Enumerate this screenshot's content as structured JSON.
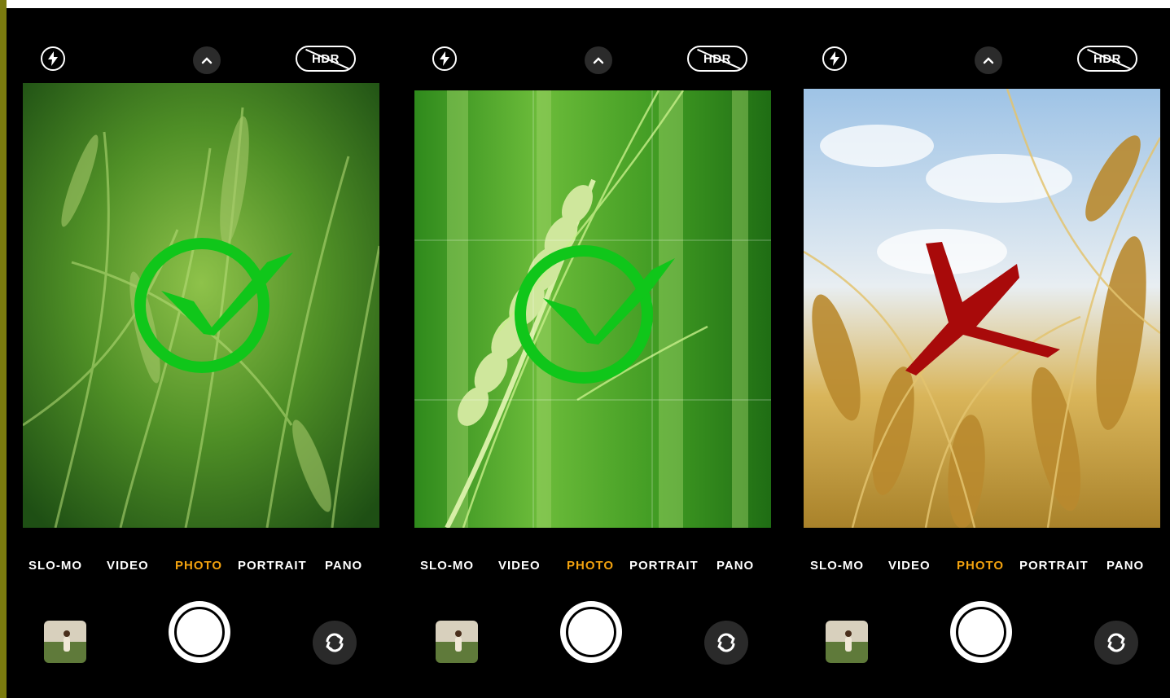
{
  "colors": {
    "accent_mode": "#f2a20f",
    "approve_mark": "#10c61a",
    "reject_mark": "#a80a0a",
    "border_strip": "#7b7b0f"
  },
  "icons": {
    "flash": "flash-icon",
    "chevron": "chevron-up-icon",
    "flip": "camera-flip-icon"
  },
  "phones": [
    {
      "hdr_label": "HDR",
      "overlay": "check-mark",
      "modes": [
        "SLO-MO",
        "VIDEO",
        "PHOTO",
        "PORTRAIT",
        "PANO"
      ],
      "active_mode": "PHOTO"
    },
    {
      "hdr_label": "HDR",
      "overlay": "check-mark",
      "grid": true,
      "modes": [
        "SLO-MO",
        "VIDEO",
        "PHOTO",
        "PORTRAIT",
        "PANO"
      ],
      "active_mode": "PHOTO"
    },
    {
      "hdr_label": "HDR",
      "overlay": "x-mark",
      "modes": [
        "SLO-MO",
        "VIDEO",
        "PHOTO",
        "PORTRAIT",
        "PANO"
      ],
      "active_mode": "PHOTO"
    }
  ]
}
